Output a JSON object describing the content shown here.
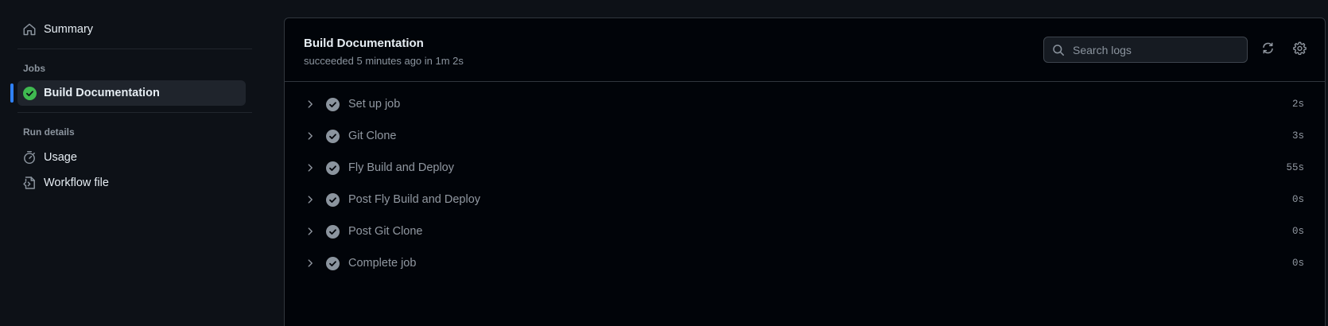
{
  "sidebar": {
    "summary_label": "Summary",
    "jobs_heading": "Jobs",
    "jobs": [
      {
        "label": "Build Documentation",
        "status": "success",
        "active": true
      }
    ],
    "run_details_heading": "Run details",
    "details": [
      {
        "label": "Usage",
        "icon": "stopwatch-icon"
      },
      {
        "label": "Workflow file",
        "icon": "file-code-icon"
      }
    ]
  },
  "job": {
    "title": "Build Documentation",
    "status_text": "succeeded 5 minutes ago in 1m 2s"
  },
  "search": {
    "placeholder": "Search logs"
  },
  "steps": [
    {
      "name": "Set up job",
      "duration": "2s"
    },
    {
      "name": "Git Clone",
      "duration": "3s"
    },
    {
      "name": "Fly Build and Deploy",
      "duration": "55s"
    },
    {
      "name": "Post Fly Build and Deploy",
      "duration": "0s"
    },
    {
      "name": "Post Git Clone",
      "duration": "0s"
    },
    {
      "name": "Complete job",
      "duration": "0s"
    }
  ],
  "colors": {
    "background": "#0d1117",
    "panel": "#010409",
    "accent": "#2f81f7",
    "success": "#3fb950",
    "muted_text": "#8b949e"
  }
}
